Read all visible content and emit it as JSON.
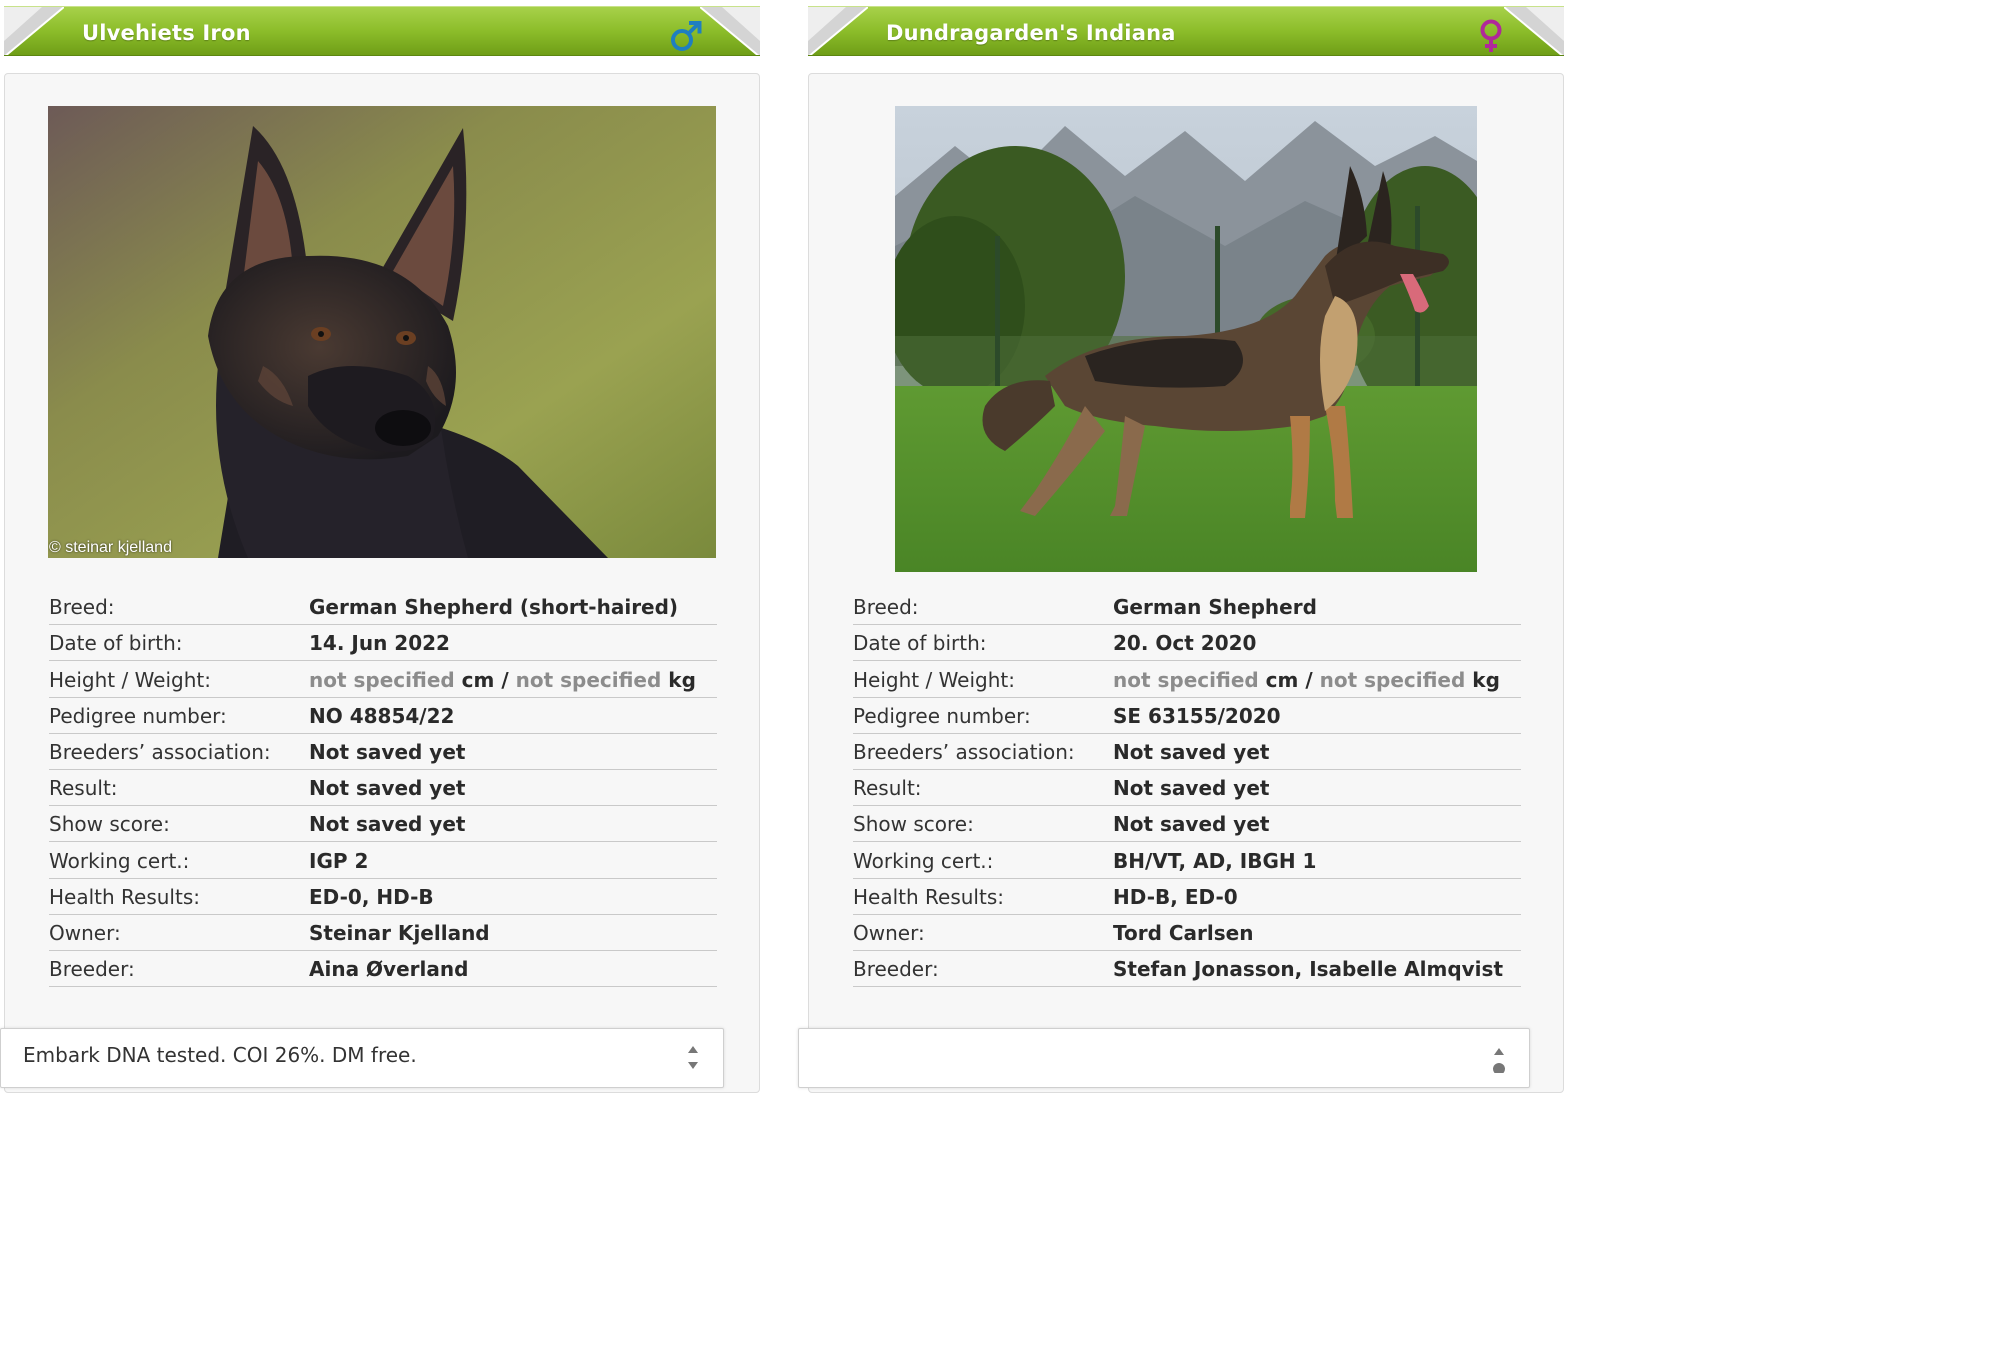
{
  "colors": {
    "header_green": "#8cbd2a",
    "male_icon": "#1f7fc0",
    "female_icon": "#b0289a",
    "muted_text": "#8c8c8c"
  },
  "left": {
    "name": "Ulvehiets Iron",
    "gender_icon": "male-icon",
    "photo_credit": "© steinar kjelland",
    "info": {
      "breed_label": "Breed:",
      "breed": "German Shepherd (short-haired)",
      "dob_label": "Date of birth:",
      "dob": "14. Jun 2022",
      "hw_label": "Height / Weight:",
      "height": "not specified",
      "height_unit": "cm /",
      "weight": "not specified",
      "weight_unit": "kg",
      "pedigree_label": "Pedigree number:",
      "pedigree": "NO 48854/22",
      "assoc_label": "Breeders’ association:",
      "assoc": "Not saved yet",
      "result_label": "Result:",
      "result": "Not saved yet",
      "show_label": "Show score:",
      "show": "Not saved yet",
      "working_label": "Working cert.:",
      "working": "IGP 2",
      "health_label": "Health Results:",
      "health": "ED-0, HD-B",
      "owner_label": "Owner:",
      "owner": "Steinar Kjelland",
      "breeder_label": "Breeder:",
      "breeder": "Aina Øverland"
    },
    "note": "Embark DNA tested. COI 26%. DM free."
  },
  "right": {
    "name": "Dundragarden's Indiana",
    "gender_icon": "female-icon",
    "info": {
      "breed_label": "Breed:",
      "breed": "German Shepherd",
      "dob_label": "Date of birth:",
      "dob": "20. Oct 2020",
      "hw_label": "Height / Weight:",
      "height": "not specified",
      "height_unit": "cm /",
      "weight": "not specified",
      "weight_unit": "kg",
      "pedigree_label": "Pedigree number:",
      "pedigree": "SE 63155/2020",
      "assoc_label": "Breeders’ association:",
      "assoc": "Not saved yet",
      "result_label": "Result:",
      "result": "Not saved yet",
      "show_label": "Show score:",
      "show": "Not saved yet",
      "working_label": "Working cert.:",
      "working": "BH/VT, AD, IBGH 1",
      "health_label": "Health Results:",
      "health": "HD-B, ED-0",
      "owner_label": "Owner:",
      "owner": "Tord Carlsen",
      "breeder_label": "Breeder:",
      "breeder": "Stefan Jonasson, Isabelle Almqvist"
    },
    "note": ""
  }
}
